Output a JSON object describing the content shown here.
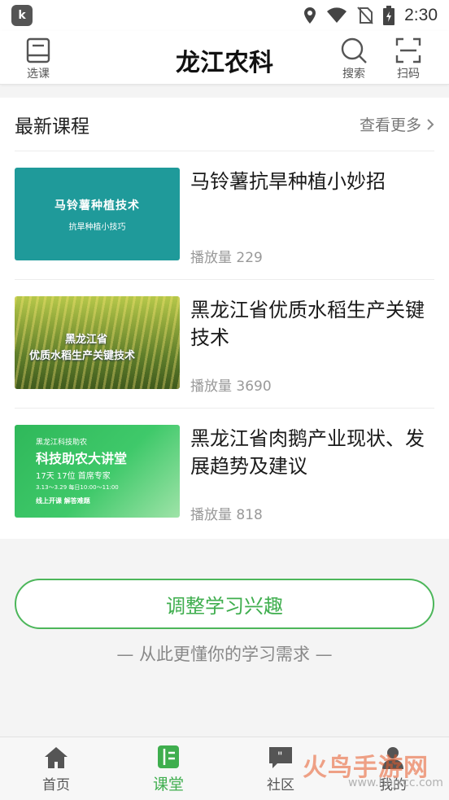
{
  "status_bar": {
    "time": "2:30",
    "app_icon_letter": "k"
  },
  "header": {
    "title": "龙江农科",
    "select_course_label": "选课",
    "search_label": "搜索",
    "scan_label": "扫码"
  },
  "latest": {
    "section_title": "最新课程",
    "more_label": "查看更多",
    "courses": [
      {
        "title": "马铃薯抗旱种植小妙招",
        "plays": "播放量 229",
        "thumb_line1": "马铃薯种植技术",
        "thumb_line2": "抗旱种植小技巧"
      },
      {
        "title": "黑龙江省优质水稻生产关键技术",
        "plays": "播放量 3690",
        "thumb_line1": "黑龙江省",
        "thumb_line2": "优质水稻生产关键技术"
      },
      {
        "title": "黑龙江省肉鹅产业现状、发展趋势及建议",
        "plays": "播放量 818",
        "thumb_line0": "黑龙江科技助农",
        "thumb_line1": "科技助农大讲堂",
        "thumb_line2": "17天 17位 首席专家",
        "thumb_line3": "3.13～3.29 每日10:00～11:00",
        "thumb_line4": "线上开课 解答难题"
      }
    ]
  },
  "interest": {
    "button_label": "调整学习兴趣",
    "subtitle": "— 从此更懂你的学习需求 —"
  },
  "tabs": [
    {
      "label": "首页"
    },
    {
      "label": "课堂"
    },
    {
      "label": "社区"
    },
    {
      "label": "我的"
    }
  ],
  "watermark": {
    "text": "火鸟手游网",
    "url": "www.hnjxcc.com"
  },
  "colors": {
    "accent": "#3fae4e",
    "thumb_teal": "#1f9a9a"
  },
  "icons": [
    "book-icon",
    "search-icon",
    "scan-icon",
    "home-icon",
    "notebook-icon",
    "chat-icon",
    "person-icon",
    "location-icon",
    "wifi-icon",
    "no-sim-icon",
    "battery-icon",
    "chevron-right-icon"
  ]
}
